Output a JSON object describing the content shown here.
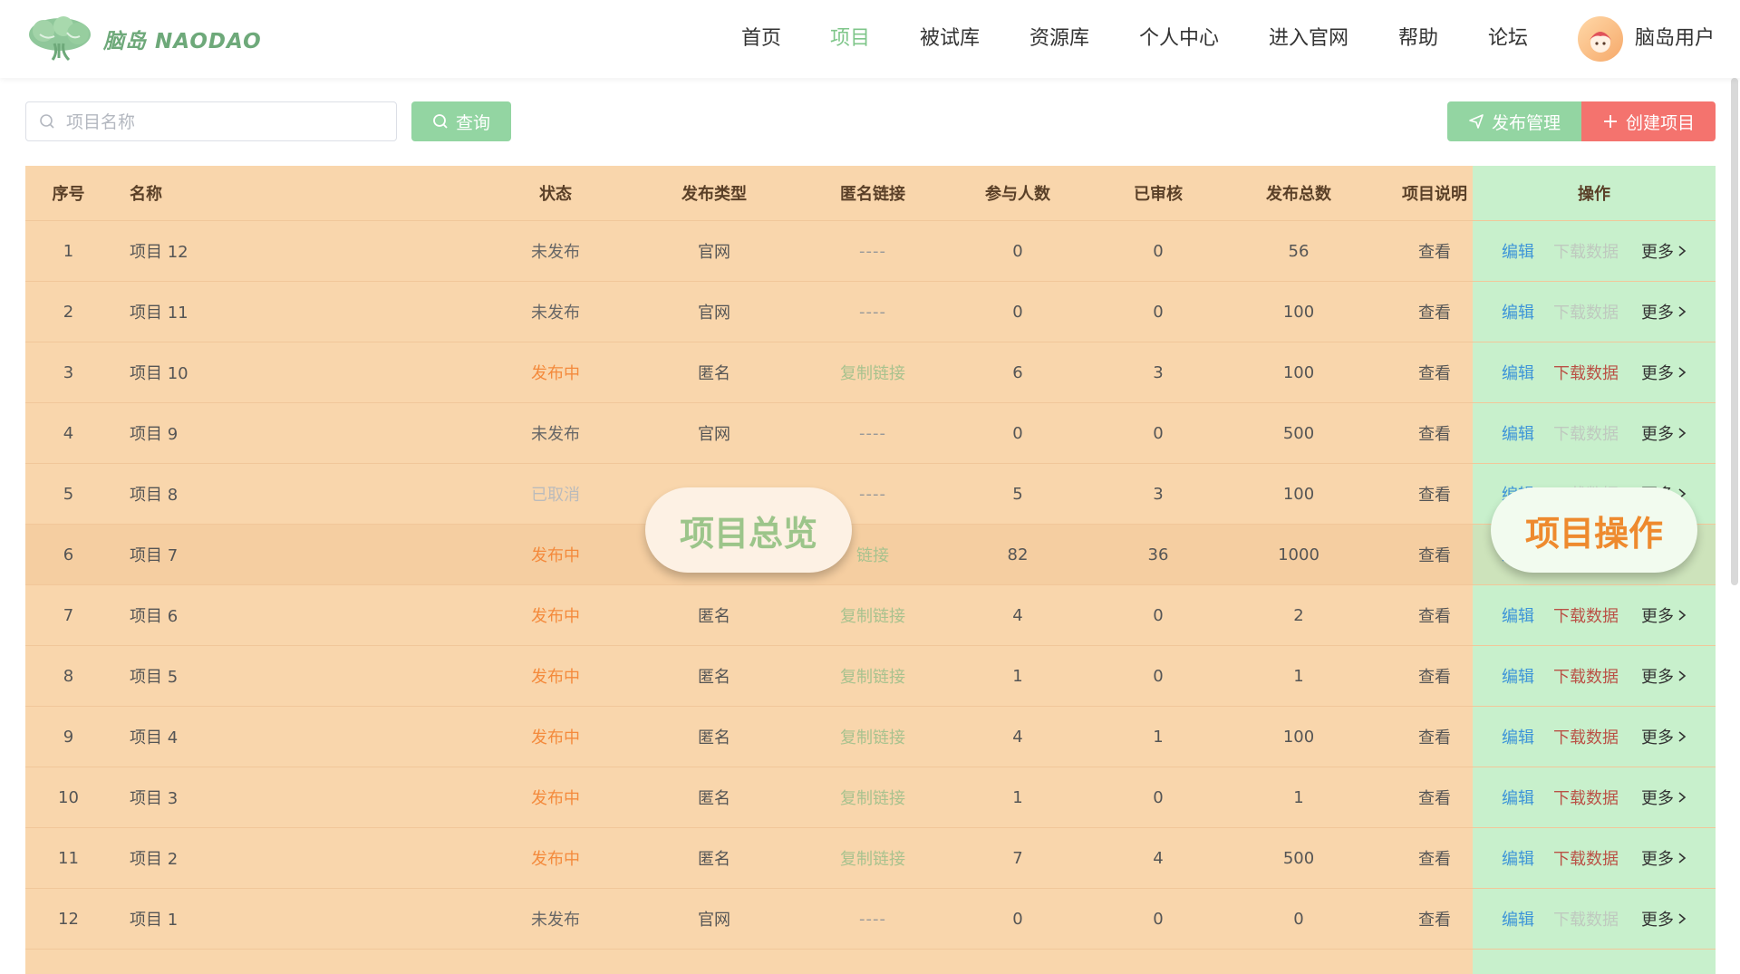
{
  "brand": {
    "name": "脑岛 NAODAO",
    "accent": "#7fc68a"
  },
  "nav": {
    "items": [
      {
        "label": "首页"
      },
      {
        "label": "项目",
        "active": true
      },
      {
        "label": "被试库"
      },
      {
        "label": "资源库"
      },
      {
        "label": "个人中心"
      },
      {
        "label": "进入官网"
      },
      {
        "label": "帮助"
      },
      {
        "label": "论坛"
      }
    ],
    "user_name": "脑岛用户"
  },
  "toolbar": {
    "search_placeholder": "项目名称",
    "search_value": "",
    "query_label": "查询",
    "publish_label": "发布管理",
    "create_label": "创建项目"
  },
  "table": {
    "headers": {
      "idx": "序号",
      "name": "名称",
      "status": "状态",
      "type": "发布类型",
      "link": "匿名链接",
      "participants": "参与人数",
      "reviewed": "已审核",
      "total": "发布总数",
      "desc": "项目说明",
      "ops": "操作"
    },
    "rows": [
      {
        "idx": "1",
        "name": "项目 12",
        "status": "未发布",
        "type": "官网",
        "link": "----",
        "participants": "0",
        "reviewed": "0",
        "total": "56",
        "desc": "查看"
      },
      {
        "idx": "2",
        "name": "项目 11",
        "status": "未发布",
        "type": "官网",
        "link": "----",
        "participants": "0",
        "reviewed": "0",
        "total": "100",
        "desc": "查看"
      },
      {
        "idx": "3",
        "name": "项目 10",
        "status": "发布中",
        "type": "匿名",
        "link": "复制链接",
        "participants": "6",
        "reviewed": "3",
        "total": "100",
        "desc": "查看"
      },
      {
        "idx": "4",
        "name": "项目 9",
        "status": "未发布",
        "type": "官网",
        "link": "----",
        "participants": "0",
        "reviewed": "0",
        "total": "500",
        "desc": "查看"
      },
      {
        "idx": "5",
        "name": "项目 8",
        "status": "已取消",
        "type": "",
        "link": "----",
        "participants": "5",
        "reviewed": "3",
        "total": "100",
        "desc": "查看"
      },
      {
        "idx": "6",
        "name": "项目 7",
        "status": "发布中",
        "type": "",
        "link": "链接",
        "participants": "82",
        "reviewed": "36",
        "total": "1000",
        "desc": "查看"
      },
      {
        "idx": "7",
        "name": "项目 6",
        "status": "发布中",
        "type": "匿名",
        "link": "复制链接",
        "participants": "4",
        "reviewed": "0",
        "total": "2",
        "desc": "查看"
      },
      {
        "idx": "8",
        "name": "项目 5",
        "status": "发布中",
        "type": "匿名",
        "link": "复制链接",
        "participants": "1",
        "reviewed": "0",
        "total": "1",
        "desc": "查看"
      },
      {
        "idx": "9",
        "name": "项目 4",
        "status": "发布中",
        "type": "匿名",
        "link": "复制链接",
        "participants": "4",
        "reviewed": "1",
        "total": "100",
        "desc": "查看"
      },
      {
        "idx": "10",
        "name": "项目 3",
        "status": "发布中",
        "type": "匿名",
        "link": "复制链接",
        "participants": "1",
        "reviewed": "0",
        "total": "1",
        "desc": "查看"
      },
      {
        "idx": "11",
        "name": "项目 2",
        "status": "发布中",
        "type": "匿名",
        "link": "复制链接",
        "participants": "7",
        "reviewed": "4",
        "total": "500",
        "desc": "查看"
      },
      {
        "idx": "12",
        "name": "项目 1",
        "status": "未发布",
        "type": "官网",
        "link": "----",
        "participants": "0",
        "reviewed": "0",
        "total": "0",
        "desc": "查看"
      }
    ],
    "ops_labels": {
      "edit": "编辑",
      "download": "下载数据",
      "more": "更多"
    }
  },
  "overlays": {
    "overview": "项目总览",
    "operations": "项目操作"
  },
  "colors": {
    "table_bg": "#f9d6ac",
    "ops_bg": "#c8f0cc",
    "status_publishing": "#f48a3c",
    "create_button": "#f4736e",
    "query_button": "#93d5a2"
  }
}
